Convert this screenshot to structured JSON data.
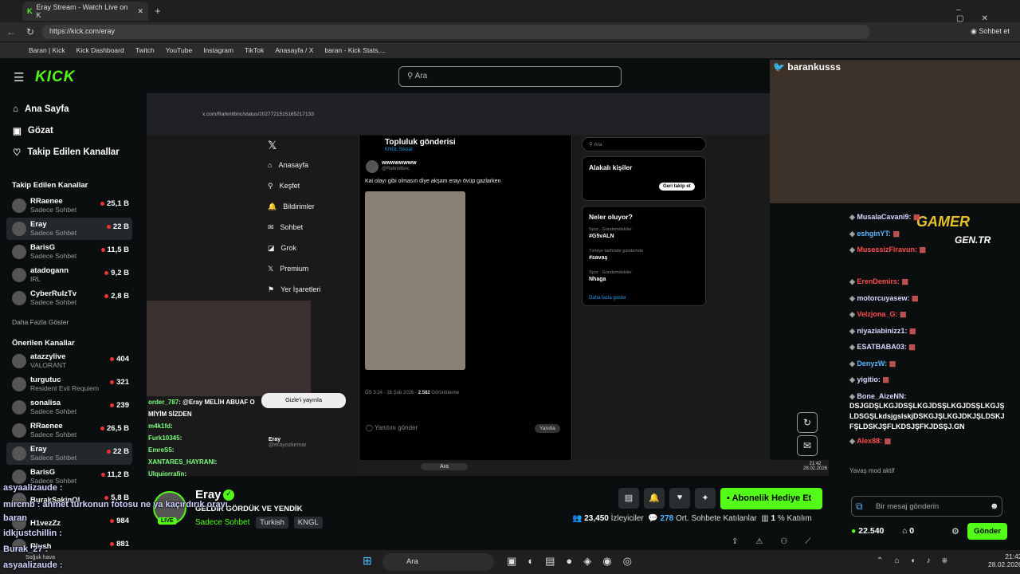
{
  "browser": {
    "tab_title": "Eray Stream - Watch Live on K",
    "url": "https://kick.com/eray",
    "copilot_label": "Sohbet et",
    "bookmarks": [
      "Baran | Kick",
      "Kick Dashboard",
      "Twitch",
      "YouTube",
      "Instagram",
      "TikTok",
      "Anasayfa / X",
      "baran - Kick Stats,..."
    ]
  },
  "kick": {
    "search_placeholder": "Ara",
    "nav": [
      "Ana Sayfa",
      "Gözat",
      "Takip Edilen Kanallar"
    ],
    "followed_title": "Takip Edilen Kanallar",
    "followed": [
      {
        "name": "RRaenee",
        "cat": "Sadece Sohbet",
        "viewers": "25,1 B"
      },
      {
        "name": "Eray",
        "cat": "Sadece Sohbet",
        "viewers": "22 B"
      },
      {
        "name": "BarisG",
        "cat": "Sadece Sohbet",
        "viewers": "11,5 B"
      },
      {
        "name": "atadogann",
        "cat": "IRL",
        "viewers": "9,2 B"
      },
      {
        "name": "CyberRulzTv",
        "cat": "Sadece Sohbet",
        "viewers": "2,8 B"
      }
    ],
    "show_more": "Daha Fazla Göster",
    "recommended_title": "Önerilen Kanallar",
    "recommended": [
      {
        "name": "atazzylive",
        "cat": "VALORANT",
        "viewers": "404"
      },
      {
        "name": "turgutuc",
        "cat": "Resident Evil Requiem",
        "viewers": "321"
      },
      {
        "name": "sonalisa",
        "cat": "Sadece Sohbet",
        "viewers": "239"
      },
      {
        "name": "RRaenee",
        "cat": "Sadece Sohbet",
        "viewers": "26,5 B"
      },
      {
        "name": "Eray",
        "cat": "Sadece Sohbet",
        "viewers": "22 B"
      },
      {
        "name": "BarisG",
        "cat": "Sadece Sohbet",
        "viewers": "11,2 B"
      },
      {
        "name": "BurakSakinOl",
        "cat": "",
        "viewers": "5,8 B"
      },
      {
        "name": "H1vezZz",
        "cat": "",
        "viewers": "984"
      },
      {
        "name": "Rlush",
        "cat": "",
        "viewers": "881"
      }
    ],
    "channel": {
      "name": "Eray",
      "title": "GELDİK GÖRDÜK VE YENDİK",
      "live": "LIVE",
      "category": "Sadece Sohbet",
      "tags": [
        "Turkish",
        "KNGL"
      ],
      "viewers": "23,450",
      "viewers_label": "İzleyiciler",
      "chatters": "278",
      "chatters_label": "Ort. Sohbete Katılanlar",
      "rate": "1",
      "rate_label": "% Katılım",
      "gift_label": "Abonelik Hediye Et"
    },
    "chat": {
      "input_placeholder": "Bir mesaj gönderin",
      "send_label": "Gönder",
      "points": "22.540",
      "drops": "0",
      "slow_mode": "Yavaş mod aktif",
      "messages": [
        {
          "user": "MusalaCavani9:",
          "color": "#d8d8ff"
        },
        {
          "user": "eshginYT:",
          "color": "#5ab7ff"
        },
        {
          "user": "MusessizFiravun:",
          "color": "#ff4d4d"
        },
        {
          "user": "ErenDemirs:",
          "color": "#ff4d4d"
        },
        {
          "user": "motorcuyasew:",
          "color": "#d8d8ff"
        },
        {
          "user": "Velzjona_G:",
          "color": "#ff4d4d"
        },
        {
          "user": "niyaziabinizz1:",
          "color": "#d8d8ff"
        },
        {
          "user": "ESATBABA03:",
          "color": "#d8d8ff"
        },
        {
          "user": "DenyzW:",
          "color": "#5ab7ff"
        },
        {
          "user": "yigitio:",
          "color": "#d8d8ff"
        },
        {
          "user": "Bone_AizeNN:",
          "color": "#d8d8ff",
          "text": "DSJGDŞLKGJDSŞLKGJDSŞLKGJDSŞLKGJŞLDSGŞLkdsjgslskjDSKGJŞLKGJDKJŞLDSKJFŞLDSKJŞFLKDSJŞFKJDSŞJ.GN"
        },
        {
          "user": "Alex88:",
          "color": "#ff4d4d"
        }
      ]
    }
  },
  "stream": {
    "x_nav": [
      "Anasayfa",
      "Keşfet",
      "Bildirimler",
      "Sohbet",
      "Grok",
      "Premium",
      "Yer İşaretleri"
    ],
    "x_header": "Topluluk gönderisi",
    "x_sub": "KNGL Social",
    "post_user": "wwwwwwww",
    "post_handle": "@Rahmitbnc",
    "post_text": "Kai olayı gibi olmasın diye akşam erayı övüp gazlarken",
    "post_time": "ÖS 3:24 · 28 Şub 2026 · ",
    "post_views": "2.582",
    "post_views_label": "Görüntüleme",
    "reply_placeholder": "Yanıtını gönder",
    "reply_button": "Yanıtla",
    "x_search": "Ara",
    "relevant": "Alakalı kişiler",
    "follow_back": "Geri takip et",
    "trending": "Neler oluyor?",
    "trends": [
      {
        "cat": "Spor · Gündemdekiler",
        "name": "#G5vALN"
      },
      {
        "cat": "Türkiye tarihinde gündemde",
        "name": "#savaş"
      },
      {
        "cat": "Spor · Gündemdekiler",
        "name": "Nhaga"
      }
    ],
    "show_more": "Daha fazla göster",
    "url": "x.com/Rahmitbnc/status/2027721515165217133",
    "footer_user": "Eray",
    "footer_handle": "@erayozkemar",
    "chat_lines": [
      {
        "u": "order_787",
        "t": ": @Eray MELİH ABUAF O"
      },
      {
        "u": "",
        "t": "MİYİM SİZDEN"
      },
      {
        "u": "m4k1fd",
        "t": ":"
      },
      {
        "u": "Furk10345",
        "t": ":"
      },
      {
        "u": "EmreS5",
        "t": ":"
      },
      {
        "u": "XANTARES_HAYRANI",
        "t": ":"
      },
      {
        "u": "Ulquiorrafin",
        "t": ":"
      }
    ],
    "popup": "Gizle'i yayınla",
    "taskbar_search": "Ara",
    "time": "21:42",
    "date": "28.02.2026"
  },
  "overlay": {
    "twitter_handle": "barankusss",
    "lines": [
      "asyaalizaude :",
      "mircmb : ahmet türkonun fotosu ne ya kaçırdırık orayı",
      "baran",
      "idkjustchillin :",
      "Burak_27 :",
      "asyaalizaude :"
    ],
    "weather": "Soğuk hava",
    "brand": "GAMER",
    "brand_sub": "GEN.TR"
  },
  "taskbar": {
    "search": "Ara",
    "time": "21:42",
    "date": "28.02.2026"
  }
}
